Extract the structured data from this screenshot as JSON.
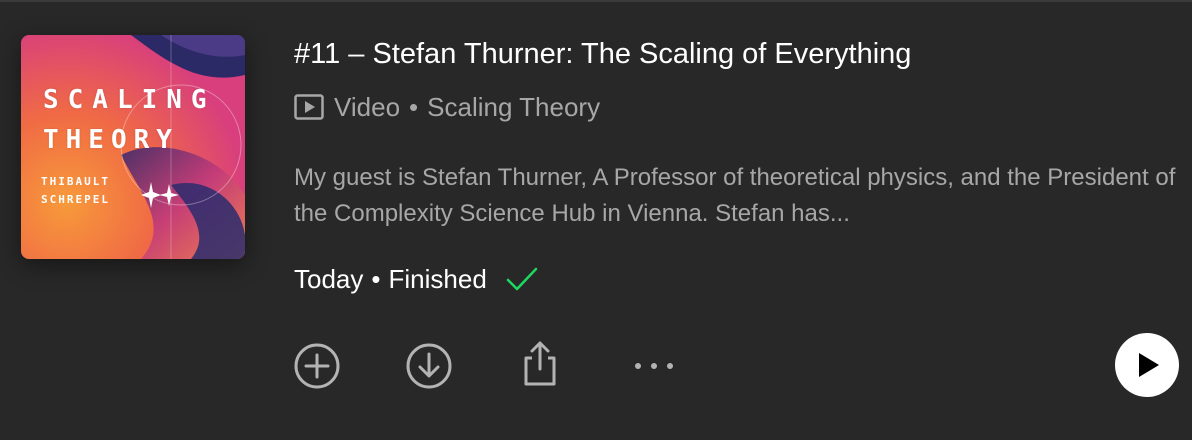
{
  "episode": {
    "title": "#11 – Stefan Thurner: The Scaling of Everything",
    "media_type": "Video",
    "separator": "•",
    "show_name": "Scaling Theory",
    "description": "My guest is Stefan Thurner, A Professor of theoretical physics, and the President of the Complexity Science Hub in Vienna. Stefan has...",
    "date": "Today",
    "status": "Finished",
    "status_color": "#1ed760"
  },
  "cover": {
    "line1": "SCALING",
    "line2": "THEORY",
    "author_first": "THIBAULT",
    "author_last": "SCHREPEL",
    "colors": [
      "#f47a3a",
      "#e23a8c",
      "#2a2b6e",
      "#7d3fa0"
    ]
  },
  "actions": {
    "add_icon": "plus-circle-icon",
    "download_icon": "download-circle-icon",
    "share_icon": "share-icon",
    "more_icon": "ellipsis-icon",
    "play_icon": "play-icon"
  }
}
